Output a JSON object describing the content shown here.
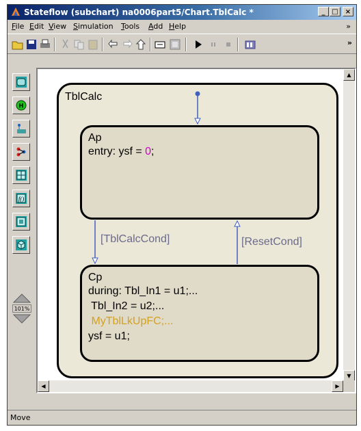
{
  "window": {
    "title": "Stateflow (subchart) na0006part5/Chart.TblCalc *",
    "controls": {
      "minimize": "_",
      "maximize": "□",
      "close": "×"
    }
  },
  "menubar": {
    "items": [
      "File",
      "Edit",
      "View",
      "Simulation",
      "Tools",
      "Add",
      "Help"
    ],
    "overflow": "»"
  },
  "toolbar": {
    "icons": [
      "open-icon",
      "save-icon",
      "print-icon",
      "cut-icon",
      "copy-icon",
      "paste-icon",
      "back-icon",
      "forward-icon",
      "up-icon",
      "undo-icon",
      "explorer-icon",
      "play-icon",
      "pause-icon",
      "stop-icon",
      "library-icon"
    ],
    "overflow": "»"
  },
  "palette": {
    "tools": [
      "state-tool",
      "history-junction-tool",
      "default-transition-tool",
      "connective-junction-tool",
      "truth-table-tool",
      "function-tool",
      "embedded-function-tool",
      "box-tool"
    ],
    "zoom_label": "101%"
  },
  "chart": {
    "subchart_name": "TblCalc",
    "state_ap": {
      "name": "Ap",
      "action_prefix": "entry: ysf = ",
      "action_value": "0",
      "action_suffix": ";"
    },
    "state_cp": {
      "name": "Cp",
      "line1": "during: Tbl_In1 = u1;...",
      "line2": " Tbl_In2 = u2;...",
      "line3": " MyTblLkUpFC;...",
      "line4": "ysf = u1;"
    },
    "transition_down": "[TblCalcCond]",
    "transition_up": "[ResetCond]",
    "colors": {
      "value_highlight": "#d000d0",
      "function_call": "#d4a020",
      "transition_label": "#6a6a8a"
    }
  },
  "statusbar": {
    "text": "Move"
  }
}
